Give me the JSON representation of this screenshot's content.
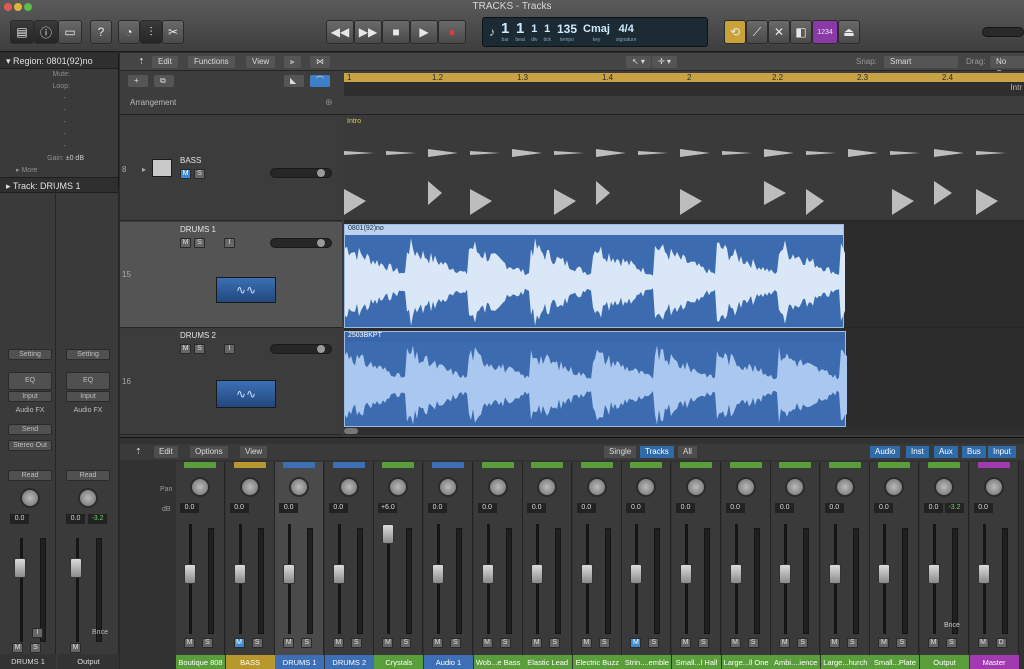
{
  "window": {
    "title": "TRACKS - Tracks"
  },
  "transport": {
    "bar": "1",
    "beat": "1",
    "div": "1",
    "tick": "1",
    "bar_lbl": "bar",
    "beat_lbl": "beat",
    "div_lbl": "div",
    "tick_lbl": "tick",
    "tempo": "135",
    "tempo_lbl": "tempo",
    "key": "Cmaj",
    "key_lbl": "key",
    "sig": "4/4",
    "sig_lbl": "signature",
    "counter": "1234"
  },
  "inspector": {
    "region_title": "Region: 0801(92)no",
    "mute": "Mute:",
    "loop": "Loop:",
    "dash": "-",
    "gain": "Gain:",
    "gain_val": "±0 dB",
    "more": "More",
    "track_title": "Track:  DRUMS 1",
    "strip_a": {
      "setting": "Setting",
      "eq": "EQ",
      "input": "Input",
      "fx": "Audio FX",
      "send": "Send",
      "out": "Stereo Out",
      "auto": "Read",
      "db": "0.0",
      "name": "DRUMS 1"
    },
    "strip_b": {
      "setting": "Setting",
      "eq": "EQ",
      "input": "Input",
      "fx": "Audio FX",
      "auto": "Read",
      "db": "0.0",
      "db2": "-3.2",
      "bounce": "Bnce",
      "name": "Output"
    },
    "m": "M",
    "s": "S",
    "i": "I"
  },
  "tracks_toolbar": {
    "edit": "Edit",
    "functions": "Functions",
    "view": "View",
    "snap_lbl": "Snap:",
    "snap_val": "Smart",
    "drag_lbl": "Drag:",
    "drag_val": "No Over",
    "arrangement": "Arrangement",
    "intro_marker": "Intro",
    "intro_right": "Intr"
  },
  "ruler": [
    "1",
    "1.2",
    "1.3",
    "1.4",
    "2",
    "2.2",
    "2.3",
    "2.4"
  ],
  "tracks": [
    {
      "num": "8",
      "name": "BASS",
      "m": "M",
      "s": "S"
    },
    {
      "num": "15",
      "name": "DRUMS 1",
      "m": "M",
      "s": "S",
      "i": "I",
      "region": "0801(92)no"
    },
    {
      "num": "16",
      "name": "DRUMS 2",
      "m": "M",
      "s": "S",
      "i": "I",
      "region": "2503BKPT"
    }
  ],
  "mixer": {
    "edit": "Edit",
    "options": "Options",
    "view": "View",
    "single": "Single",
    "tracks": "Tracks",
    "all": "All",
    "audio": "Audio",
    "inst": "Inst",
    "aux": "Aux",
    "bus": "Bus",
    "input": "Input",
    "pan_lbl": "Pan",
    "db_lbl": "dB",
    "strips": [
      {
        "name": "Boutique 808",
        "db": "0.0",
        "color": "#5a9e3b"
      },
      {
        "name": "BASS",
        "db": "0.0",
        "color": "#b8972e"
      },
      {
        "name": "DRUMS 1",
        "db": "0.0",
        "color": "#3c6fb5"
      },
      {
        "name": "DRUMS 2",
        "db": "0.0",
        "color": "#3c6fb5"
      },
      {
        "name": "Crystals",
        "db": "+6.0",
        "color": "#5a9e3b"
      },
      {
        "name": "Audio 1",
        "db": "0.0",
        "color": "#3c6fb5"
      },
      {
        "name": "Wob...e Bass",
        "db": "0.0",
        "color": "#5a9e3b"
      },
      {
        "name": "Elastic Lead",
        "db": "0.0",
        "color": "#5a9e3b"
      },
      {
        "name": "Electric Buzz",
        "db": "0.0",
        "color": "#5a9e3b"
      },
      {
        "name": "Strin....emble",
        "db": "0.0",
        "color": "#5a9e3b"
      },
      {
        "name": "Small...l Hall",
        "db": "0.0",
        "color": "#5a9e3b"
      },
      {
        "name": "Large...ll One",
        "db": "0.0",
        "color": "#5a9e3b"
      },
      {
        "name": "Ambi....ience",
        "db": "0.0",
        "color": "#5a9e3b"
      },
      {
        "name": "Large...hurch",
        "db": "0.0",
        "color": "#5a9e3b"
      },
      {
        "name": "Small...Plate",
        "db": "0.0",
        "color": "#5a9e3b"
      },
      {
        "name": "Output",
        "db": "0.0",
        "db2": "-3.2",
        "bounce": "Bnce",
        "color": "#5a9e3b"
      },
      {
        "name": "Master",
        "db": "0.0",
        "color": "#a13ab0"
      }
    ],
    "m": "M",
    "s": "S",
    "d": "D"
  },
  "colors": {
    "audio_region": "#6c97d4",
    "region_bg": "#3d6bb0",
    "waveform": "#d9e7f7",
    "ruler": "#caa246",
    "selected_tab": "#2f6aa9"
  }
}
